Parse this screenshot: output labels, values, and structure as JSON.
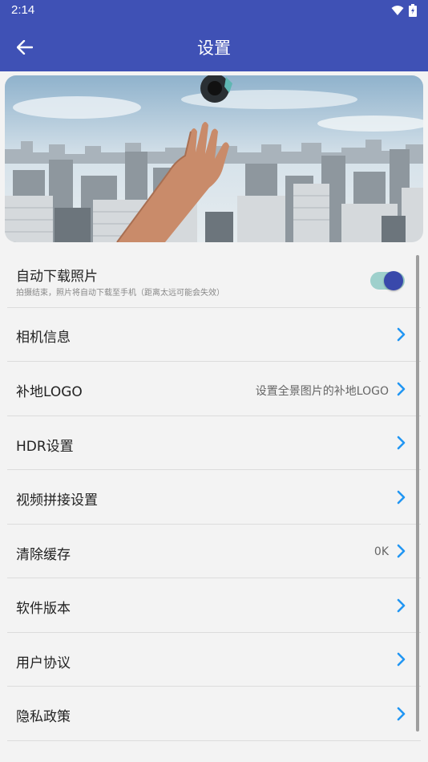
{
  "status_bar": {
    "time": "2:14"
  },
  "app_bar": {
    "title": "设置"
  },
  "colors": {
    "primary": "#3f51b5",
    "accent": "#2196f3",
    "toggle_track": "#9ed0cc",
    "toggle_thumb": "#3949ab"
  },
  "banner": {
    "icon": "hand-city-camera-photo"
  },
  "settings": {
    "auto_download": {
      "label": "自动下载照片",
      "subtitle": "拍摄结束，照片将自动下载至手机（距离太远可能会失效）",
      "enabled": true
    },
    "camera_info": {
      "label": "相机信息"
    },
    "logo": {
      "label": "补地LOGO",
      "value": "设置全景图片的补地LOGO"
    },
    "hdr": {
      "label": "HDR设置"
    },
    "video_stitch": {
      "label": "视频拼接设置"
    },
    "clear_cache": {
      "label": "清除缓存",
      "value": "0K"
    },
    "version": {
      "label": "软件版本"
    },
    "agreement": {
      "label": "用户协议"
    },
    "privacy": {
      "label": "隐私政策"
    }
  }
}
